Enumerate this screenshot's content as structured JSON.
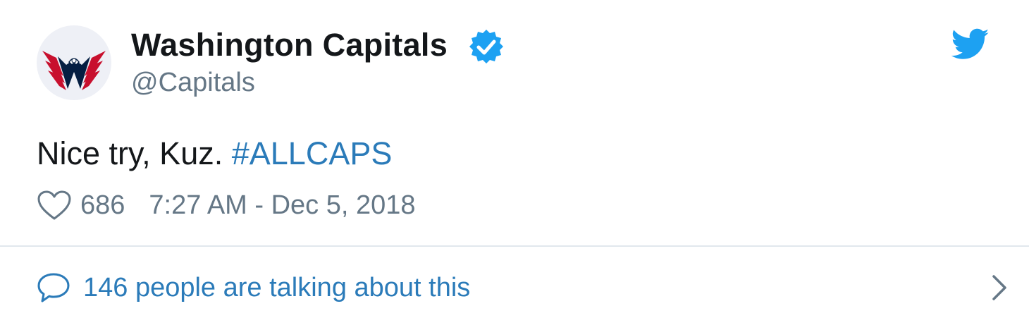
{
  "author": {
    "display_name": "Washington Capitals",
    "handle": "@Capitals",
    "verified": true,
    "avatar_icon": "capitals-logo-icon"
  },
  "tweet": {
    "text": "Nice try, Kuz. ",
    "hashtag": "#ALLCAPS",
    "like_count": "686",
    "timestamp": "7:27 AM - Dec 5, 2018"
  },
  "footer": {
    "conversation_label": "146 people are talking about this"
  },
  "icons": {
    "brand": "twitter-bird-icon",
    "like": "heart-icon",
    "reply": "reply-bubble-icon",
    "more": "chevron-right-icon",
    "verified": "verified-badge-icon"
  },
  "colors": {
    "accent": "#1da1f2",
    "link": "#2b7bb9",
    "secondary_text": "#657786",
    "primary_text": "#14171a",
    "divider": "#e1e8ed"
  }
}
